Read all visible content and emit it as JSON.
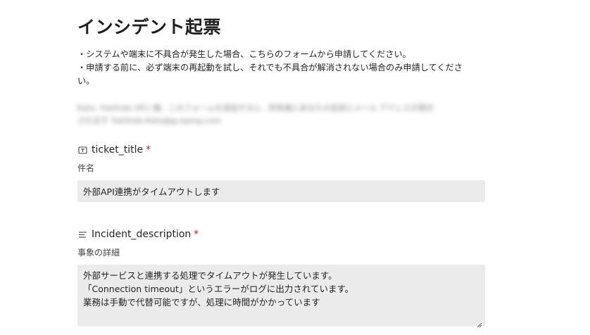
{
  "form": {
    "title": "インシデント起票",
    "description_lines": [
      "・システムや端末に不具合が発生した場合、こちらのフォームから申請してください。",
      "・申請する前に、必ず端末の再起動を試し、それでも不具合が解消されない場合のみ申請してくださ",
      "い。"
    ],
    "notice_lines": [
      "Kato, Yukihide (KC) 様、このフォームを送信すると、所有者にあなたの名前とメール アドレスが表示",
      "されます Yukihide.Kato@jp.kpmg.com"
    ]
  },
  "questions": [
    {
      "icon": "text-field-icon",
      "label": "ticket_title",
      "required_mark": "*",
      "subtitle": "件名",
      "value": "外部API連携がタイムアウトします"
    },
    {
      "icon": "long-text-icon",
      "label": "Incident_description",
      "required_mark": "*",
      "subtitle": "事象の詳細",
      "value_lines": [
        "外部サービスと連携する処理でタイムアウトが発生しています。",
        "「Connection timeout」というエラーがログに出力されています。",
        "業務は手動で代替可能ですが、処理に時間がかかっています"
      ]
    }
  ],
  "colors": {
    "required": "#a4262c",
    "input_background": "#ebebeb"
  }
}
